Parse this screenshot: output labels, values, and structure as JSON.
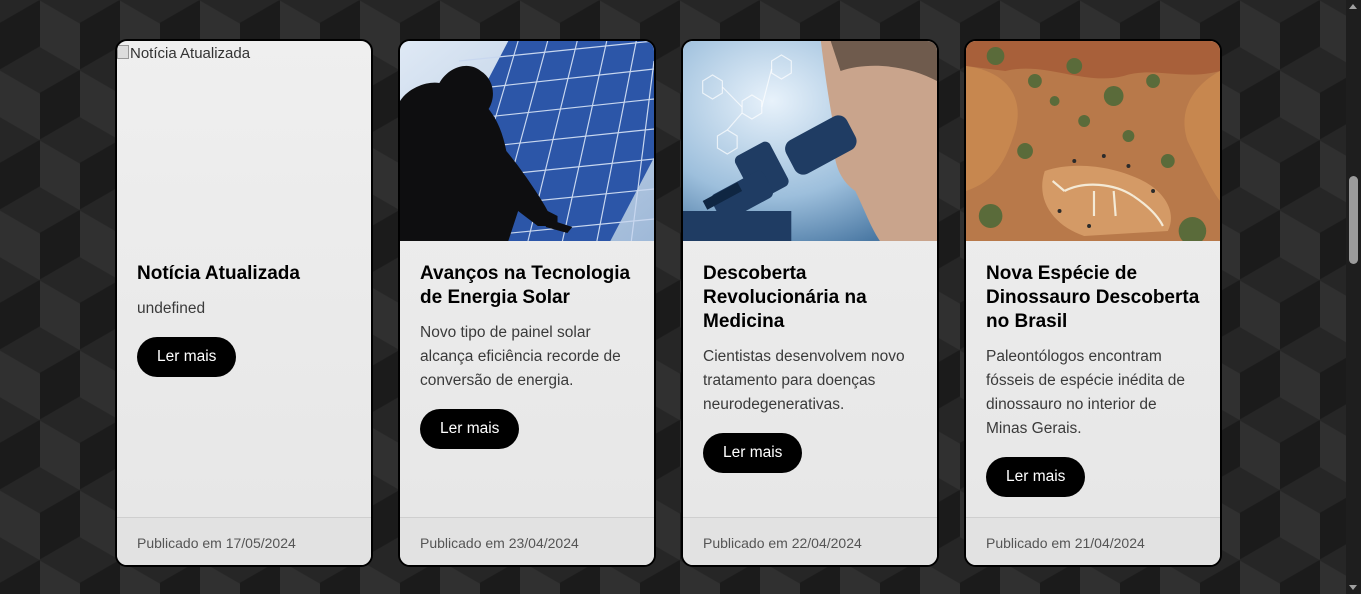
{
  "cards": [
    {
      "image_alt": "Notícia Atualizada",
      "image_broken": true,
      "title": "Notícia Atualizada",
      "description": "undefined",
      "button_label": "Ler mais",
      "date_text": "Publicado em 17/05/2024"
    },
    {
      "image_subject": "solar-panels-worker",
      "title": "Avanços na Tecnologia de Energia Solar",
      "description": "Novo tipo de painel solar alcança eficiência recorde de conversão de energia.",
      "button_label": "Ler mais",
      "date_text": "Publicado em 23/04/2024"
    },
    {
      "image_subject": "scientist-microscope",
      "title": "Descoberta Revolucionária na Medicina",
      "description": "Cientistas desenvolvem novo tratamento para doenças neurodegenerativas.",
      "button_label": "Ler mais",
      "date_text": "Publicado em 22/04/2024"
    },
    {
      "image_subject": "dinosaur-fossil-dig-site",
      "title": "Nova Espécie de Dinossauro Descoberta no Brasil",
      "description": "Paleontólogos encontram fósseis de espécie inédita de dinossauro no interior de Minas Gerais.",
      "button_label": "Ler mais",
      "date_text": "Publicado em 21/04/2024"
    }
  ],
  "colors": {
    "page_background": "#1b1b1b",
    "card_background": "#ececec",
    "button_background": "#000000",
    "button_text": "#ffffff"
  }
}
